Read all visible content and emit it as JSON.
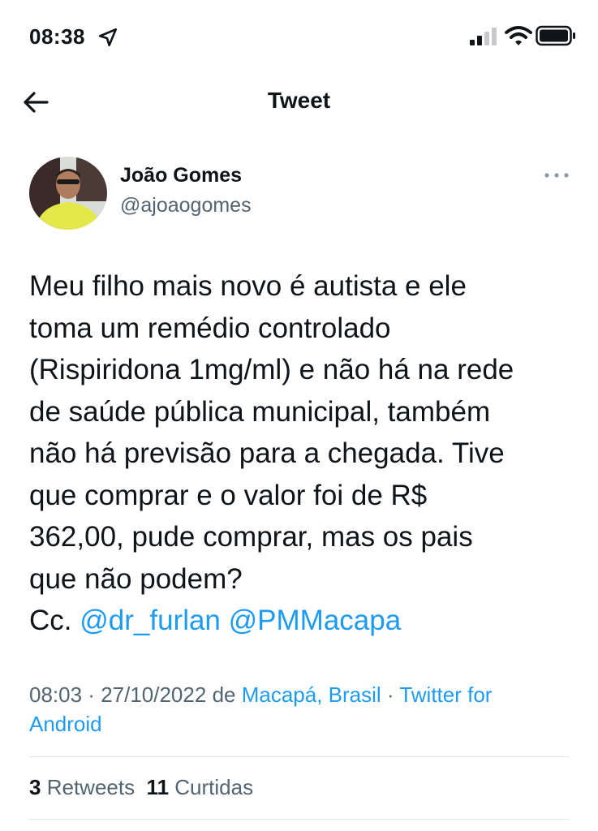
{
  "status_bar": {
    "time": "08:38"
  },
  "header": {
    "title": "Tweet"
  },
  "author": {
    "name": "João Gomes",
    "handle": "@ajoaogomes"
  },
  "tweet": {
    "lines": [
      "Meu filho mais novo é autista e ele",
      "toma um remédio controlado",
      "(Rispiridona 1mg/ml) e não há na rede",
      "de saúde pública municipal, também",
      "não há previsão para a chegada. Tive",
      "que comprar e o valor foi de R$",
      "362,00, pude comprar, mas os pais",
      "que não podem?"
    ],
    "cc_prefix": "Cc.",
    "mentions": [
      "@dr_furlan",
      "@PMMacapa"
    ]
  },
  "meta": {
    "time": "08:03",
    "date": "27/10/2022",
    "from_word": "de",
    "location": "Macapá, Brasil",
    "source_line1": "Twitter for",
    "source_line2": "Android"
  },
  "stats": {
    "retweets_count": "3",
    "retweets_label": "Retweets",
    "likes_count": "11",
    "likes_label": "Curtidas"
  },
  "colors": {
    "link": "#1d9bf0",
    "secondary_text": "#536471",
    "primary_text": "#0f1419"
  },
  "icons": [
    "location-arrow-icon",
    "signal-icon",
    "wifi-icon",
    "battery-icon",
    "back-arrow-icon",
    "more-icon"
  ]
}
